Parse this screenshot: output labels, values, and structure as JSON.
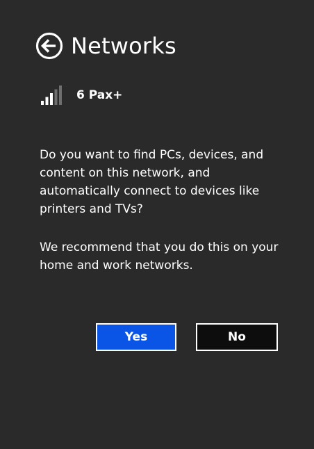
{
  "header": {
    "title": "Networks",
    "back_icon": "back-arrow-circle-icon"
  },
  "network": {
    "name": "6 Pax+",
    "signal_icon": "wifi-signal-bars-icon",
    "signal_bars_total": 5,
    "signal_bars_strong": 3
  },
  "message": {
    "question": "Do you want to find PCs, devices, and content on this network, and automatically connect to devices like printers and TVs?",
    "recommendation": "We recommend that you do this on your home and work networks."
  },
  "buttons": {
    "yes_label": "Yes",
    "no_label": "No"
  },
  "colors": {
    "background": "#2a2a2a",
    "yes_button": "#0a55e6",
    "no_button": "#0d0d0d",
    "text": "#ffffff",
    "signal_weak": "#6e6e6e"
  }
}
